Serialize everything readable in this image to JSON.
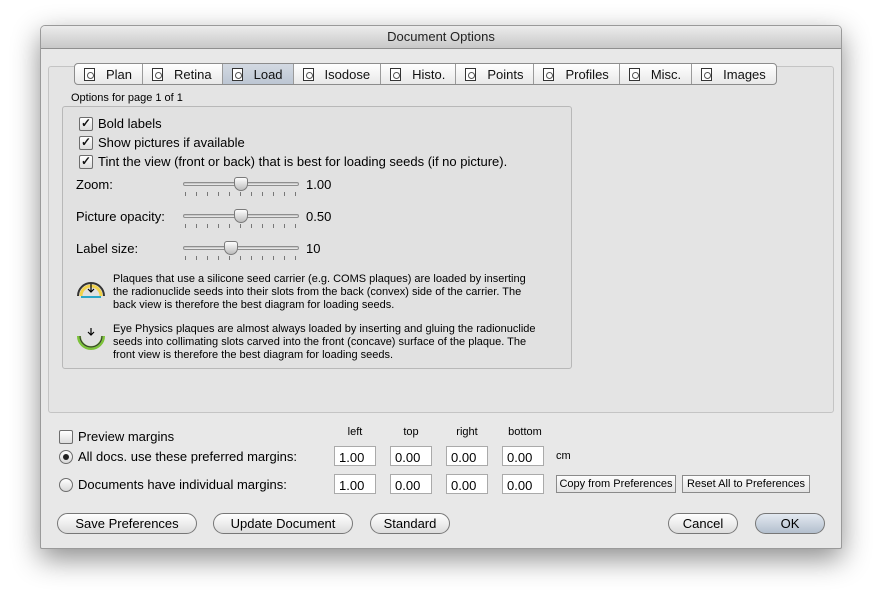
{
  "window": {
    "title": "Document Options"
  },
  "tabs": [
    {
      "label": "Plan",
      "icon": "plan-icon"
    },
    {
      "label": "Retina",
      "icon": "retina-icon"
    },
    {
      "label": "Load",
      "icon": "load-icon"
    },
    {
      "label": "Isodose",
      "icon": "isodose-icon"
    },
    {
      "label": "Histo.",
      "icon": "histo-icon"
    },
    {
      "label": "Points",
      "icon": "points-icon"
    },
    {
      "label": "Profiles",
      "icon": "profiles-icon"
    },
    {
      "label": "Misc.",
      "icon": "misc-icon"
    },
    {
      "label": "Images",
      "icon": "images-icon"
    }
  ],
  "active_tab": "Load",
  "page_label": "Options for page 1 of 1",
  "load": {
    "checkboxes": [
      {
        "label": "Bold labels",
        "checked": true
      },
      {
        "label": "Show pictures if available",
        "checked": true
      },
      {
        "label": "Tint the view (front or back) that is best for loading seeds (if no picture).",
        "checked": true
      }
    ],
    "sliders": {
      "zoom": {
        "label": "Zoom:",
        "value": "1.00",
        "fraction": 0.5
      },
      "opacity": {
        "label": "Picture opacity:",
        "value": "0.50",
        "fraction": 0.5
      },
      "label_size": {
        "label": "Label size:",
        "value": "10",
        "fraction": 0.4
      }
    },
    "notes": {
      "back": "Plaques that use a silicone seed carrier (e.g. COMS plaques) are loaded by inserting the radionuclide seeds into their slots from the back (convex) side of the carrier. The back view is therefore the best diagram for loading seeds.",
      "front": "Eye Physics plaques are almost always loaded by inserting and gluing the radionuclide seeds into collimating slots carved into the front (concave) surface of the plaque. The front view is therefore the best diagram for loading seeds."
    }
  },
  "margins": {
    "preview_label": "Preview margins",
    "preview_checked": false,
    "columns": [
      "left",
      "top",
      "right",
      "bottom"
    ],
    "option_all": "All docs. use these preferred margins:",
    "option_individual": "Documents have individual margins:",
    "selected": "all",
    "preferred": [
      "1.00",
      "0.00",
      "0.00",
      "0.00"
    ],
    "individual": [
      "1.00",
      "0.00",
      "0.00",
      "0.00"
    ],
    "unit": "cm",
    "copy_button": "Copy from Preferences",
    "reset_button": "Reset All to Preferences"
  },
  "buttons": {
    "save": "Save Preferences",
    "update": "Update Document",
    "standard": "Standard",
    "cancel": "Cancel",
    "ok": "OK"
  }
}
